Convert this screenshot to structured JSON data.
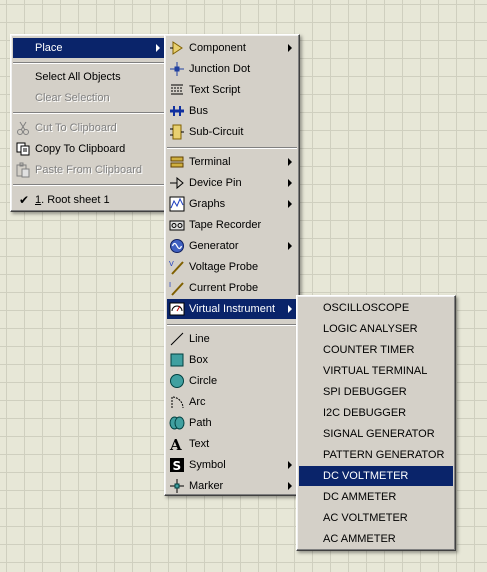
{
  "menu1": {
    "place_label": "Place",
    "select_all_label": "Select All Objects",
    "clear_selection_label": "Clear Selection",
    "cut_label": "Cut To Clipboard",
    "copy_label": "Copy To Clipboard",
    "paste_label": "Paste From Clipboard",
    "root_sheet_prefix": "1",
    "root_sheet_label": ". Root sheet 1"
  },
  "menu2": {
    "items": [
      {
        "label": "Component",
        "icon": "component-icon"
      },
      {
        "label": "Junction Dot",
        "icon": "junction-dot-icon"
      },
      {
        "label": "Text Script",
        "icon": "text-script-icon"
      },
      {
        "label": "Bus",
        "icon": "bus-icon"
      },
      {
        "label": "Sub-Circuit",
        "icon": "sub-circuit-icon"
      },
      {
        "label": "Terminal",
        "icon": "terminal-icon"
      },
      {
        "label": "Device Pin",
        "icon": "device-pin-icon"
      },
      {
        "label": "Graphs",
        "icon": "graphs-icon"
      },
      {
        "label": "Tape Recorder",
        "icon": "tape-recorder-icon"
      },
      {
        "label": "Generator",
        "icon": "generator-icon"
      },
      {
        "label": "Voltage Probe",
        "icon": "voltage-probe-icon"
      },
      {
        "label": "Current Probe",
        "icon": "current-probe-icon"
      },
      {
        "label": "Virtual Instrument",
        "icon": "virtual-instrument-icon"
      },
      {
        "label": "Line",
        "icon": "line-icon"
      },
      {
        "label": "Box",
        "icon": "box-icon"
      },
      {
        "label": "Circle",
        "icon": "circle-icon"
      },
      {
        "label": "Arc",
        "icon": "arc-icon"
      },
      {
        "label": "Path",
        "icon": "path-icon"
      },
      {
        "label": "Text",
        "icon": "text-icon"
      },
      {
        "label": "Symbol",
        "icon": "symbol-icon"
      },
      {
        "label": "Marker",
        "icon": "marker-icon"
      }
    ]
  },
  "menu3": {
    "items": [
      "OSCILLOSCOPE",
      "LOGIC ANALYSER",
      "COUNTER TIMER",
      "VIRTUAL TERMINAL",
      "SPI DEBUGGER",
      "I2C DEBUGGER",
      "SIGNAL GENERATOR",
      "PATTERN GENERATOR",
      "DC VOLTMETER",
      "DC AMMETER",
      "AC VOLTMETER",
      "AC AMMETER"
    ],
    "selected": "DC VOLTMETER"
  },
  "colors": {
    "menu_bg": "#d4d0c8",
    "highlight": "#0a246a",
    "disabled_text": "#808080",
    "canvas_bg": "#e7e7d7",
    "grid_line": "#cfcfbf"
  }
}
